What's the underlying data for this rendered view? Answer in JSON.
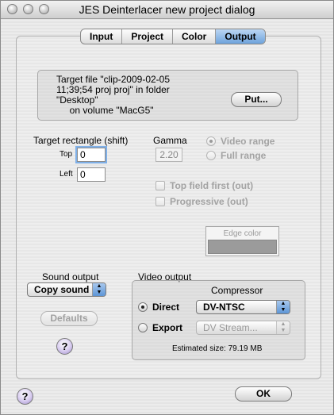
{
  "window": {
    "title": "JES Deinterlacer new project dialog"
  },
  "tabs": [
    {
      "label": "Input",
      "active": false
    },
    {
      "label": "Project",
      "active": false
    },
    {
      "label": "Color",
      "active": false
    },
    {
      "label": "Output",
      "active": true
    }
  ],
  "target_file": {
    "text": "Target file \"clip-2009-02-05\n11;39;54 proj proj\" in folder\n\"Desktop\"\n     on volume \"MacG5\"",
    "put_button": "Put..."
  },
  "target_rect": {
    "heading": "Target rectangle (shift)",
    "top_label": "Top",
    "top_value": "0",
    "left_label": "Left",
    "left_value": "0"
  },
  "gamma": {
    "heading": "Gamma",
    "value": "2.20"
  },
  "range": {
    "video_range": "Video range",
    "full_range": "Full range",
    "selected": "video_range"
  },
  "field_options": {
    "top_field_first": "Top field first (out)",
    "progressive": "Progressive (out)"
  },
  "edge_color": {
    "label": "Edge color",
    "color": "#9b9b9b"
  },
  "sound": {
    "heading": "Sound output",
    "selected": "Copy sound"
  },
  "defaults_button": "Defaults",
  "video_output": {
    "heading": "Video output",
    "compressor_heading": "Compressor",
    "direct_label": "Direct",
    "direct_codec": "DV-NTSC",
    "export_label": "Export",
    "export_format": "DV Stream...",
    "selected": "direct",
    "estimated_size": "Estimated size: 79.19 MB"
  },
  "ok_button": "OK",
  "help_symbol": "?",
  "colors": {
    "accent": "#6ea3dc",
    "disabled_text": "#a3a3a3"
  }
}
